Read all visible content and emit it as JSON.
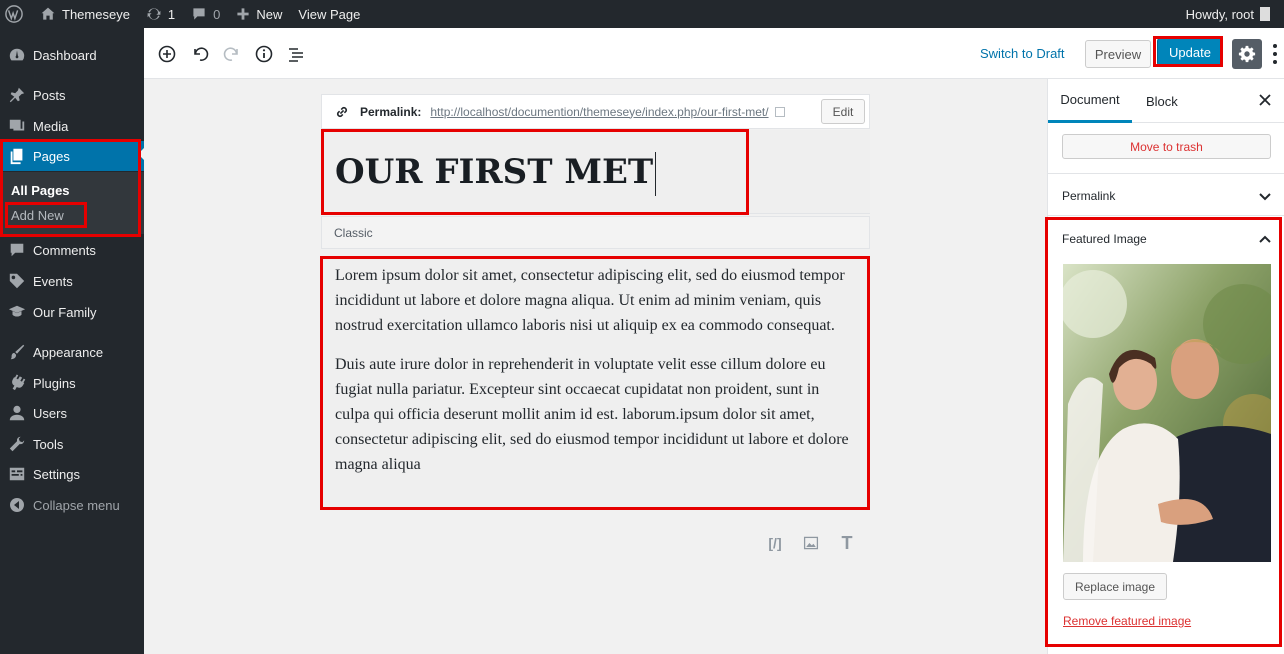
{
  "admin_bar": {
    "site_name": "Themeseye",
    "updates_count": "1",
    "comments_count": "0",
    "new_label": "New",
    "view_page_label": "View Page",
    "howdy": "Howdy, root"
  },
  "sidebar": {
    "items": [
      {
        "label": "Dashboard",
        "icon": "dashboard-icon"
      },
      {
        "label": "Posts",
        "icon": "pin-icon"
      },
      {
        "label": "Media",
        "icon": "media-icon"
      },
      {
        "label": "Pages",
        "icon": "pages-icon"
      },
      {
        "label": "Comments",
        "icon": "comment-icon"
      },
      {
        "label": "Events",
        "icon": "tag-icon"
      },
      {
        "label": "Our Family",
        "icon": "graduation-cap-icon"
      },
      {
        "label": "Appearance",
        "icon": "brush-icon"
      },
      {
        "label": "Plugins",
        "icon": "plugin-icon"
      },
      {
        "label": "Users",
        "icon": "user-icon"
      },
      {
        "label": "Tools",
        "icon": "wrench-icon"
      },
      {
        "label": "Settings",
        "icon": "settings-icon"
      }
    ],
    "submenu": [
      "All Pages",
      "Add New"
    ],
    "collapse_label": "Collapse menu"
  },
  "toolbar": {
    "switch_to_draft": "Switch to Draft",
    "preview": "Preview",
    "update": "Update"
  },
  "editor": {
    "permalink_label": "Permalink:",
    "permalink_url": "http://localhost/documention/themeseye/index.php/our-first-met/",
    "edit_label": "Edit",
    "title": "OUR FIRST MET",
    "classic_label": "Classic",
    "paragraphs": [
      "Lorem ipsum dolor sit amet, consectetur adipiscing elit, sed do eiusmod tempor incididunt ut labore et dolore magna aliqua. Ut enim ad minim veniam, quis nostrud exercitation ullamco laboris nisi ut aliquip ex ea commodo consequat.",
      "Duis aute irure dolor in reprehenderit in voluptate velit esse cillum dolore eu fugiat nulla pariatur. Excepteur sint occaecat cupidatat non proident, sunt in culpa qui officia deserunt mollit anim id est. laborum.ipsum dolor sit amet, consectetur adipiscing elit, sed do eiusmod tempor incididunt ut labore et dolore magna aliqua"
    ],
    "inserter_shortcode": "[/]",
    "inserter_text": "T"
  },
  "panel": {
    "tab_document": "Document",
    "tab_block": "Block",
    "move_to_trash": "Move to trash",
    "permalink_heading": "Permalink",
    "featured_image_heading": "Featured Image",
    "replace_image": "Replace image",
    "remove_featured_image": "Remove featured image"
  },
  "colors": {
    "admin_dark": "#23282d",
    "accent_blue": "#0085ba",
    "highlight_red": "#e60000"
  }
}
